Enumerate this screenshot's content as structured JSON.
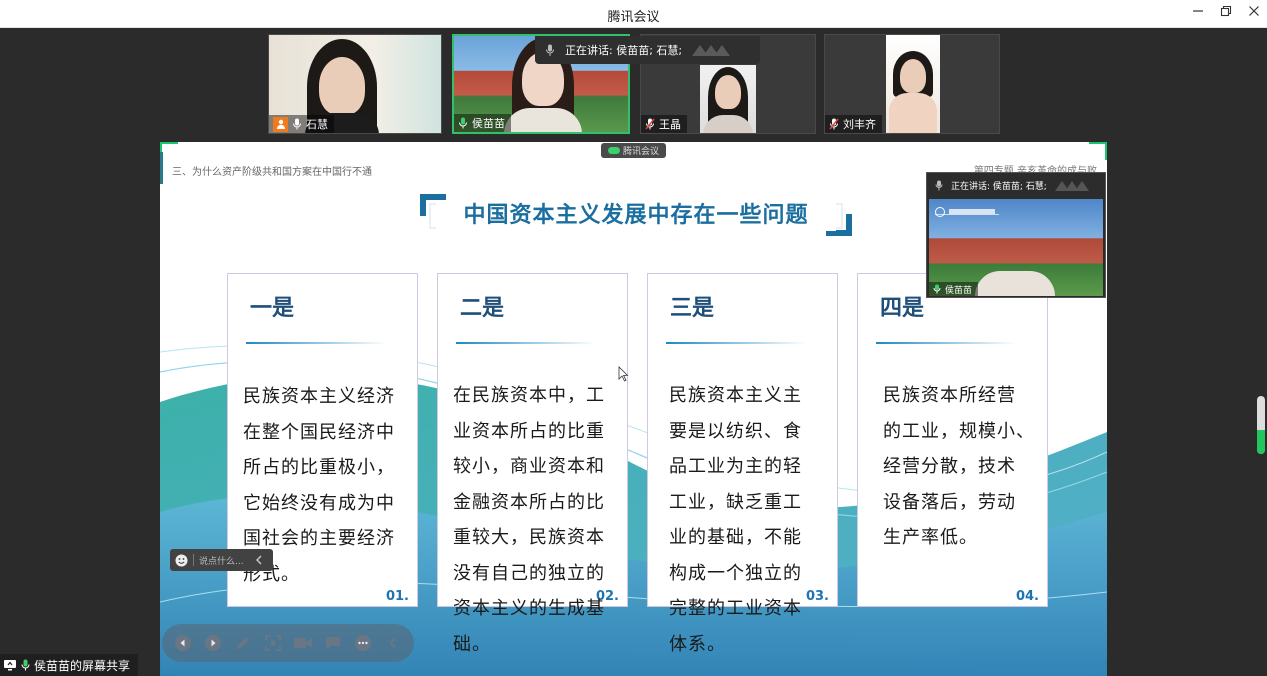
{
  "window": {
    "title": "腾讯会议"
  },
  "participants": [
    {
      "name": "石慧"
    },
    {
      "name": "侯苗苗"
    },
    {
      "name": "王晶"
    },
    {
      "name": "刘丰齐"
    }
  ],
  "speaking_banner": {
    "label": "正在讲话: 侯苗苗; 石慧;"
  },
  "app_badge": {
    "label": "腾讯会议"
  },
  "slide": {
    "breadcrumb": "三、为什么资产阶级共和国方案在中国行不通",
    "topic": "第四专题 辛亥革命的成与败",
    "heading": "中国资本主义发展中存在一些问题",
    "cards": [
      {
        "title": "一是",
        "number": "01.",
        "lines": [
          "民族资本主义经济",
          "在整个国民经济中",
          "所占的比重极小，",
          "它始终没有成为中",
          "国社会的主要经济",
          "形式。"
        ]
      },
      {
        "title": "二是",
        "number": "02.",
        "lines": [
          "在民族资本中，工",
          "业资本所占的比重",
          "较小，商业资本和",
          "金融资本所占的比",
          "重较大，民族资本",
          "没有自己的独立的",
          "资本主义的生成基",
          "础。"
        ]
      },
      {
        "title": "三是",
        "number": "03.",
        "lines": [
          "民族资本主义主",
          "要是以纺织、食",
          "品工业为主的轻",
          "工业，缺乏重工",
          "业的基础，不能",
          "构成一个独立的",
          "完整的工业资本",
          "体系。"
        ]
      },
      {
        "title": "四是",
        "number": "04.",
        "lines": [
          "民族资本所经营",
          "的工业，规模小、",
          "经营分散，技术",
          "设备落后，劳动",
          "生产率低。"
        ]
      }
    ]
  },
  "self_view": {
    "speaking": "正在讲话: 侯苗苗; 石慧;",
    "name": "侯苗苗"
  },
  "chat": {
    "placeholder": "说点什么..."
  },
  "share_label": "侯苗苗的屏幕共享",
  "colors": {
    "accent_green": "#32c06a",
    "heading_blue": "#1b6fa0",
    "card_title": "#1f4e79"
  }
}
